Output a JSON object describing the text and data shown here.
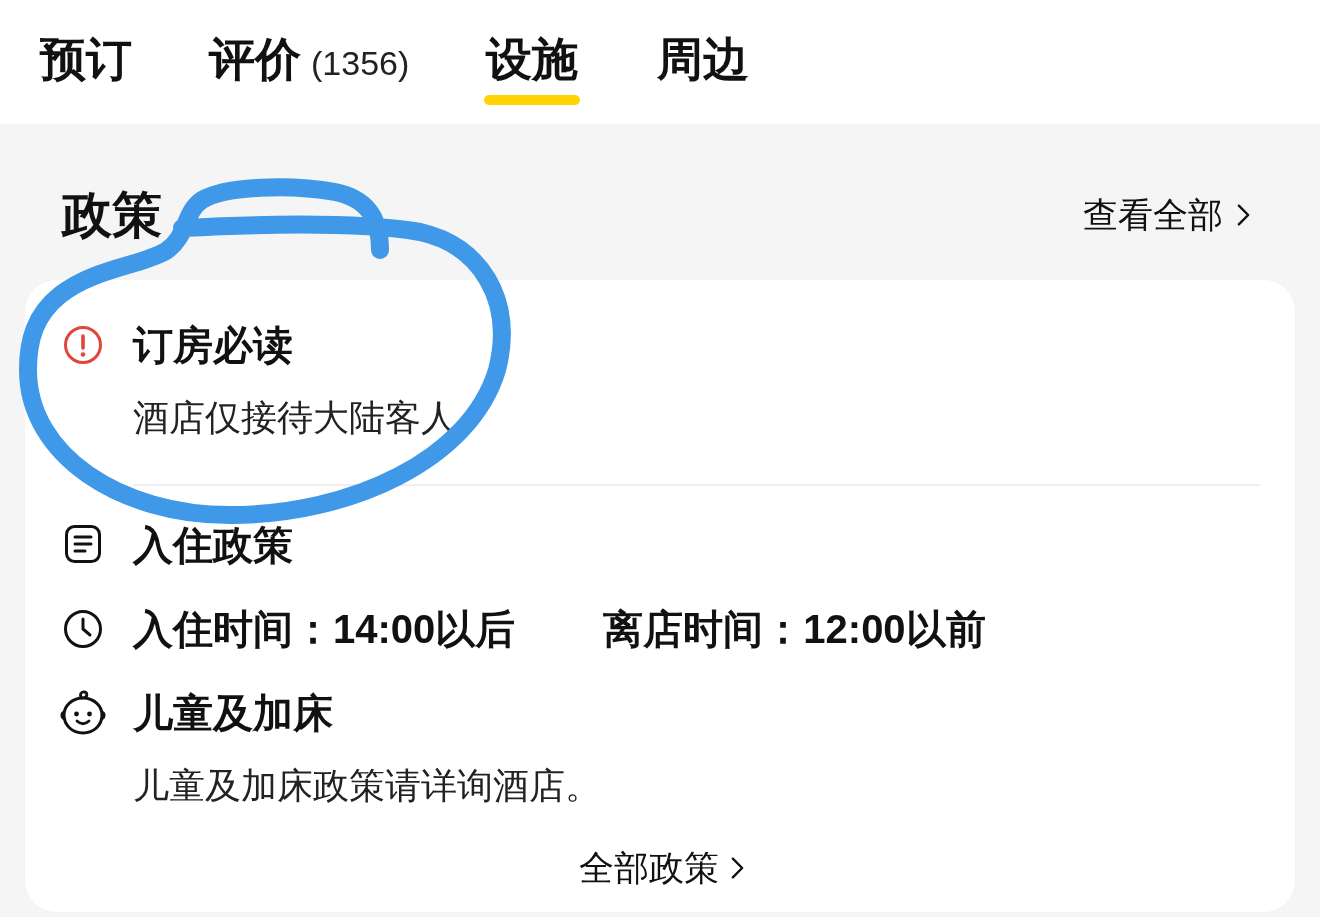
{
  "tabs": [
    {
      "label": "预订",
      "selected": false
    },
    {
      "label": "评价",
      "count": "(1356)",
      "selected": false
    },
    {
      "label": "设施",
      "selected": true
    },
    {
      "label": "周边",
      "selected": false
    }
  ],
  "policy": {
    "title": "政策",
    "view_all": "查看全部",
    "items": [
      {
        "kind": "notice",
        "title": "订房必读",
        "text": "酒店仅接待大陆客人"
      },
      {
        "kind": "checkin",
        "title": "入住政策"
      },
      {
        "kind": "times",
        "texts": [
          "入住时间：14:00以后",
          "离店时间：12:00以前"
        ]
      },
      {
        "kind": "children",
        "title": "儿童及加床",
        "text": "儿童及加床政策请详询酒店。"
      }
    ],
    "all_policies": "全部政策"
  },
  "annotation": {
    "kind": "loop"
  }
}
